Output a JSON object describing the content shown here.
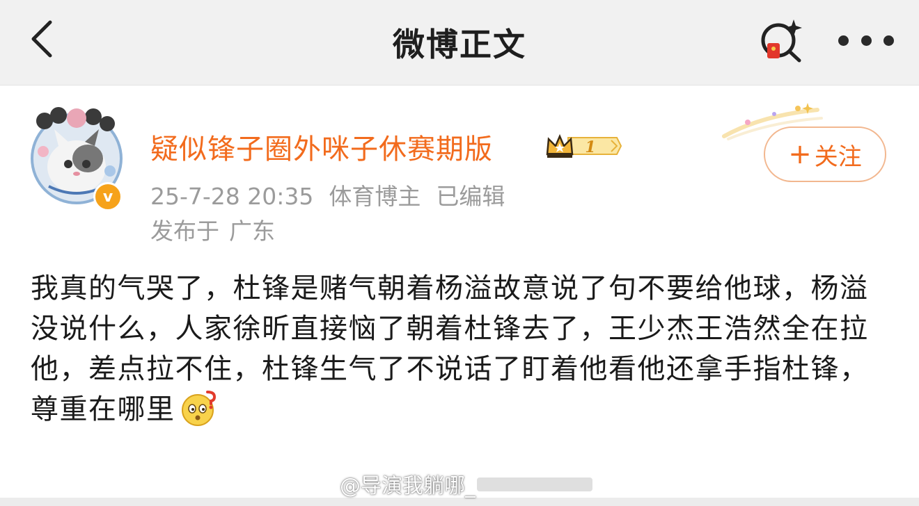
{
  "header": {
    "title": "微博正文"
  },
  "author": {
    "name": "疑似锋子圈外咪子休赛期版",
    "level": "1",
    "verified_mark": "v",
    "follow_label": "关注",
    "follow_plus": "+"
  },
  "meta": {
    "timestamp": "25-7-28 20:35",
    "role": "体育博主",
    "edited": "已编辑",
    "location_prefix": "发布于",
    "location": "广东"
  },
  "post": {
    "text": "我真的气哭了，杜锋是赌气朝着杨溢故意说了句不要给他球，杨溢没说什么，人家徐昕直接恼了朝着杜锋去了，王少杰王浩然全在拉他，差点拉不住，杜锋生气了不说话了盯着他看他还拿手指杜锋，尊重在哪里"
  },
  "watermark": {
    "text": "@导演我躺哪_"
  },
  "colors": {
    "accent": "#f26b1d",
    "follow_border": "#f2b78f",
    "meta_gray": "#9b9b9b",
    "badge_gold": "#f6a21a"
  },
  "icons": {
    "back": "chevron-left-icon",
    "share": "search-sparkle-icon",
    "more": "more-dots-icon"
  }
}
